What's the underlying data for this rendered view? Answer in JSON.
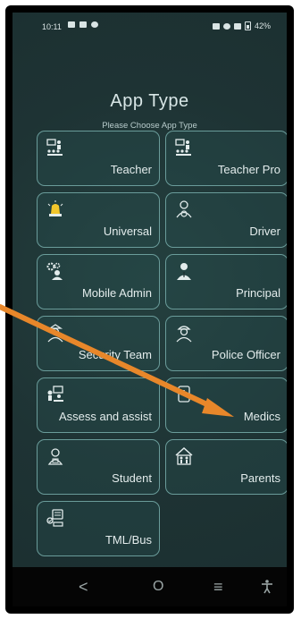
{
  "status": {
    "time": "10:11",
    "battery": "42%"
  },
  "header": {
    "title": "App Type",
    "subtitle": "Please Choose App Type"
  },
  "tiles": [
    {
      "label": "Teacher",
      "icon": "teacher-classroom-icon"
    },
    {
      "label": "Teacher Pro",
      "icon": "teacher-pro-classroom-icon"
    },
    {
      "label": "Universal",
      "icon": "alarm-siren-icon"
    },
    {
      "label": "Driver",
      "icon": "bus-driver-icon"
    },
    {
      "label": "Mobile Admin",
      "icon": "admin-gears-icon"
    },
    {
      "label": "Principal",
      "icon": "principal-person-icon"
    },
    {
      "label": "Security Team",
      "icon": "security-officer-icon"
    },
    {
      "label": "Police Officer",
      "icon": "police-officer-icon"
    },
    {
      "label": "Assess and assist",
      "icon": "assess-assist-icon"
    },
    {
      "label": "Medics",
      "icon": "medical-kit-icon"
    },
    {
      "label": "Student",
      "icon": "student-icon"
    },
    {
      "label": "Parents",
      "icon": "family-house-icon"
    },
    {
      "label": "TML/Bus",
      "icon": "bus-checklist-icon"
    }
  ],
  "nav": {
    "back": "<",
    "home": "O",
    "recents": "≡",
    "accessibility": "accessibility-icon"
  },
  "colors": {
    "background": "#1f3536",
    "tile_border": "#6a9c9a",
    "annotation_arrow": "#e8872a"
  }
}
